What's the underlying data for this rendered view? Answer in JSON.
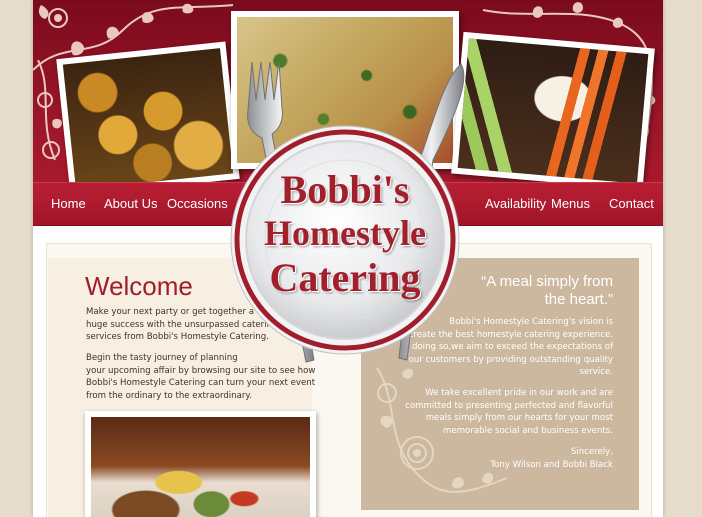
{
  "brand": {
    "line1": "Bobbi's",
    "line2": "Homestyle",
    "line3": "Catering"
  },
  "nav": {
    "home": "Home",
    "about": "About Us",
    "occasions": "Occasions",
    "availability": "Availability",
    "menus": "Menus",
    "contact": "Contact"
  },
  "welcome": {
    "title": "Welcome",
    "para1": [
      "Make your next party or get together a",
      "huge success with the unsurpassed catering",
      "services from Bobbi's Homestyle Catering."
    ],
    "para2": [
      "Begin the tasty journey of planning",
      "your upcoming affair by browsing our site to see how",
      "Bobbi's Homestyle Catering can turn your next event",
      "from the ordinary to the extraordinary."
    ]
  },
  "quote": {
    "line1": "“A meal simply from",
    "line2": "the heart.”"
  },
  "about": {
    "para1": [
      "Bobbi's Homestyle Catering's vision is",
      "to create the best homestyle catering experience.",
      "In doing so,we aim to exceed the expectations of",
      "our customers by providing outstanding quality",
      "service."
    ],
    "para2": [
      "We take excellent pride in our work and are",
      "committed to presenting perfected and flavorful",
      "meals simply from our hearts for your most",
      "memorable social and business events."
    ],
    "closing": "Sincerely,",
    "signature": "Tony Wilson and Bobbi Black"
  },
  "colors": {
    "brand_red": "#a01e2c",
    "header_red": "#9a1528",
    "panel_tan": "#cbb89f",
    "background": "#e6dccb"
  },
  "icons": [
    "fork-icon",
    "knife-icon",
    "plate-icon",
    "rose-vine-decoration"
  ]
}
